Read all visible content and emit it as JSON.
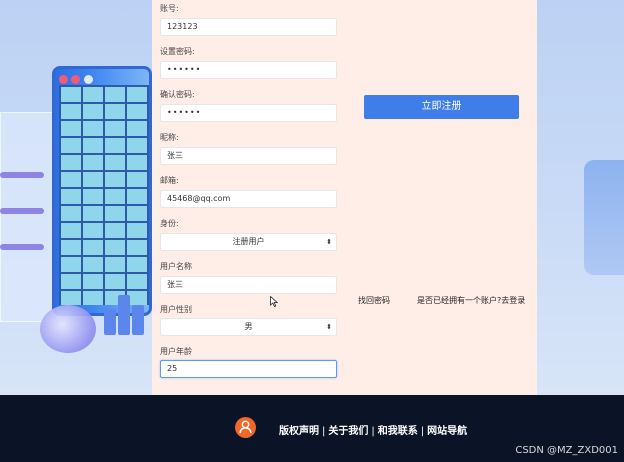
{
  "form": {
    "fields": [
      {
        "label": "账号:",
        "value": "123123",
        "type": "text"
      },
      {
        "label": "设置密码:",
        "value": "••••••",
        "type": "password"
      },
      {
        "label": "确认密码:",
        "value": "••••••",
        "type": "password"
      },
      {
        "label": "昵称:",
        "value": "张三",
        "type": "text"
      },
      {
        "label": "邮箱:",
        "value": "45468@qq.com",
        "type": "text"
      },
      {
        "label": "身份:",
        "value": "注册用户",
        "type": "select"
      },
      {
        "label": "用户名称",
        "value": "张三",
        "type": "text"
      },
      {
        "label": "用户性别",
        "value": "男",
        "type": "select"
      },
      {
        "label": "用户年龄",
        "value": "25",
        "type": "text"
      }
    ]
  },
  "actions": {
    "submit_label": "立即注册",
    "forgot_label": "找回密码",
    "login_label": "是否已经拥有一个账户?去登录"
  },
  "footer": {
    "links": [
      "版权声明",
      "关于我们",
      "和我联系",
      "网站导航"
    ],
    "separator": "|",
    "icon": "user-icon",
    "watermark": "CSDN @MZ_ZXD001"
  },
  "colors": {
    "accent": "#3f7de8",
    "panel": "#ffeee8",
    "footer_bg": "#0b1326",
    "footer_icon": "#f0672a"
  }
}
